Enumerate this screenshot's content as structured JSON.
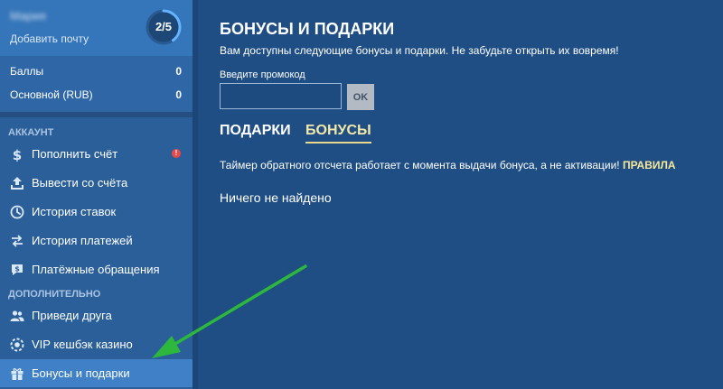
{
  "profile": {
    "name": "Мария",
    "add_email": "Добавить почту",
    "progress_label": "2/5",
    "progress_fraction": 0.4
  },
  "balances": [
    {
      "label": "Баллы",
      "value": "0"
    },
    {
      "label": "Основной (RUB)",
      "value": "0"
    }
  ],
  "sections": {
    "account": "АККАУНТ",
    "additional": "ДОПОЛНИТЕЛЬНО"
  },
  "menu": {
    "deposit": "Пополнить счёт",
    "withdraw": "Вывести со счёта",
    "bet_history": "История ставок",
    "payment_history": "История платежей",
    "payment_requests": "Платёжные обращения",
    "invite_friend": "Приведи друга",
    "vip_cashback": "VIP кешбэк казино",
    "bonuses_gifts": "Бонусы и подарки",
    "alert_glyph": "!"
  },
  "main": {
    "title": "БОНУСЫ И ПОДАРКИ",
    "subtitle": "Вам доступны следующие бонусы и подарки. Не забудьте открыть их вовремя!",
    "promo_label": "Введите промокод",
    "promo_value": "",
    "ok_label": "OK",
    "tabs": {
      "gifts": "ПОДАРКИ",
      "bonuses": "БОНУСЫ"
    },
    "timer_note": "Таймер обратного отсчета работает с момента выдачи бонуса, а не активации!",
    "rules_link": "ПРАВИЛА",
    "empty": "Ничего не найдено"
  },
  "colors": {
    "background": "#1f4e84",
    "accent_gold": "#f4e8a8",
    "arrow_green": "#2db83d",
    "alert_red": "#e84a4a"
  }
}
